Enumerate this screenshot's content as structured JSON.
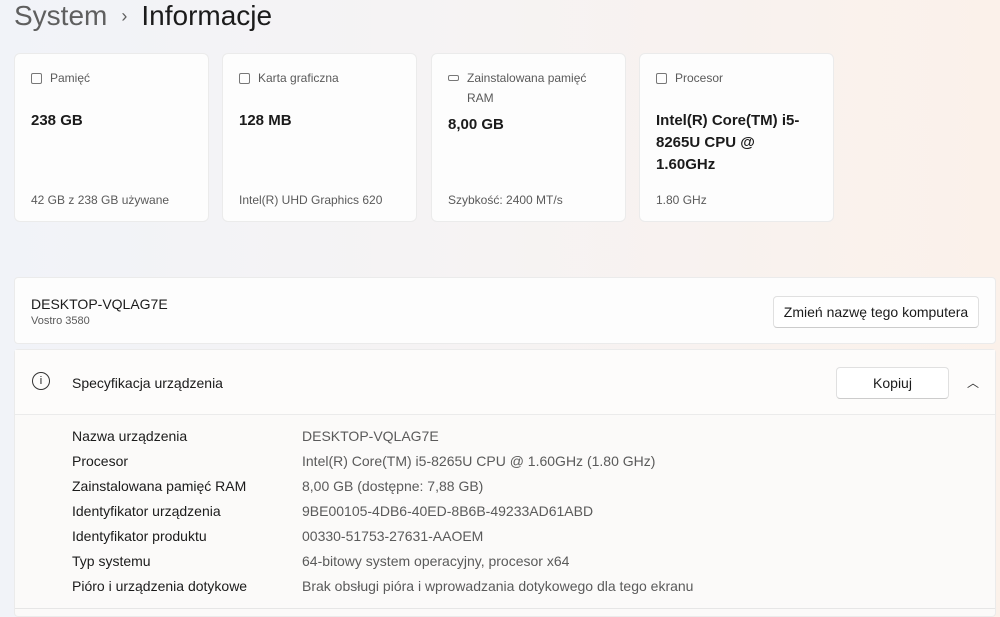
{
  "header": {
    "crumb": "System",
    "separator": "›",
    "title": "Informacje"
  },
  "cards": [
    {
      "label": "Pamięć",
      "value": "238 GB",
      "sub": "42 GB z 238 GB używane",
      "icon": "storage-icon"
    },
    {
      "label": "Karta graficzna",
      "value": "128 MB",
      "sub": "Intel(R) UHD Graphics 620",
      "icon": "gpu-icon"
    },
    {
      "label": "Zainstalowana pamięć RAM",
      "value": "8,00 GB",
      "sub": "Szybkość: 2400 MT/s",
      "icon": "ram-icon"
    },
    {
      "label": "Procesor",
      "value": "Intel(R) Core(TM) i5-8265U CPU @ 1.60GHz",
      "sub": "1.80 GHz",
      "icon": "cpu-icon"
    }
  ],
  "device": {
    "name": "DESKTOP-VQLAG7E",
    "model": "Vostro 3580",
    "rename_label": "Zmień nazwę tego komputera"
  },
  "spec": {
    "title": "Specyfikacja urządzenia",
    "copy_label": "Kopiuj",
    "rows": [
      {
        "k": "Nazwa urządzenia",
        "v": "DESKTOP-VQLAG7E"
      },
      {
        "k": "Procesor",
        "v": "Intel(R) Core(TM) i5-8265U CPU @ 1.60GHz (1.80 GHz)"
      },
      {
        "k": "Zainstalowana pamięć RAM",
        "v": "8,00 GB (dostępne: 7,88 GB)"
      },
      {
        "k": "Identyfikator urządzenia",
        "v": "9BE00105-4DB6-40ED-8B6B-49233AD61ABD"
      },
      {
        "k": "Identyfikator produktu",
        "v": "00330-51753-27631-AAOEM"
      },
      {
        "k": "Typ systemu",
        "v": "64-bitowy system operacyjny, procesor x64"
      },
      {
        "k": "Pióro i urządzenia dotykowe",
        "v": "Brak obsługi pióra i wprowadzania dotykowego dla tego ekranu"
      }
    ]
  }
}
